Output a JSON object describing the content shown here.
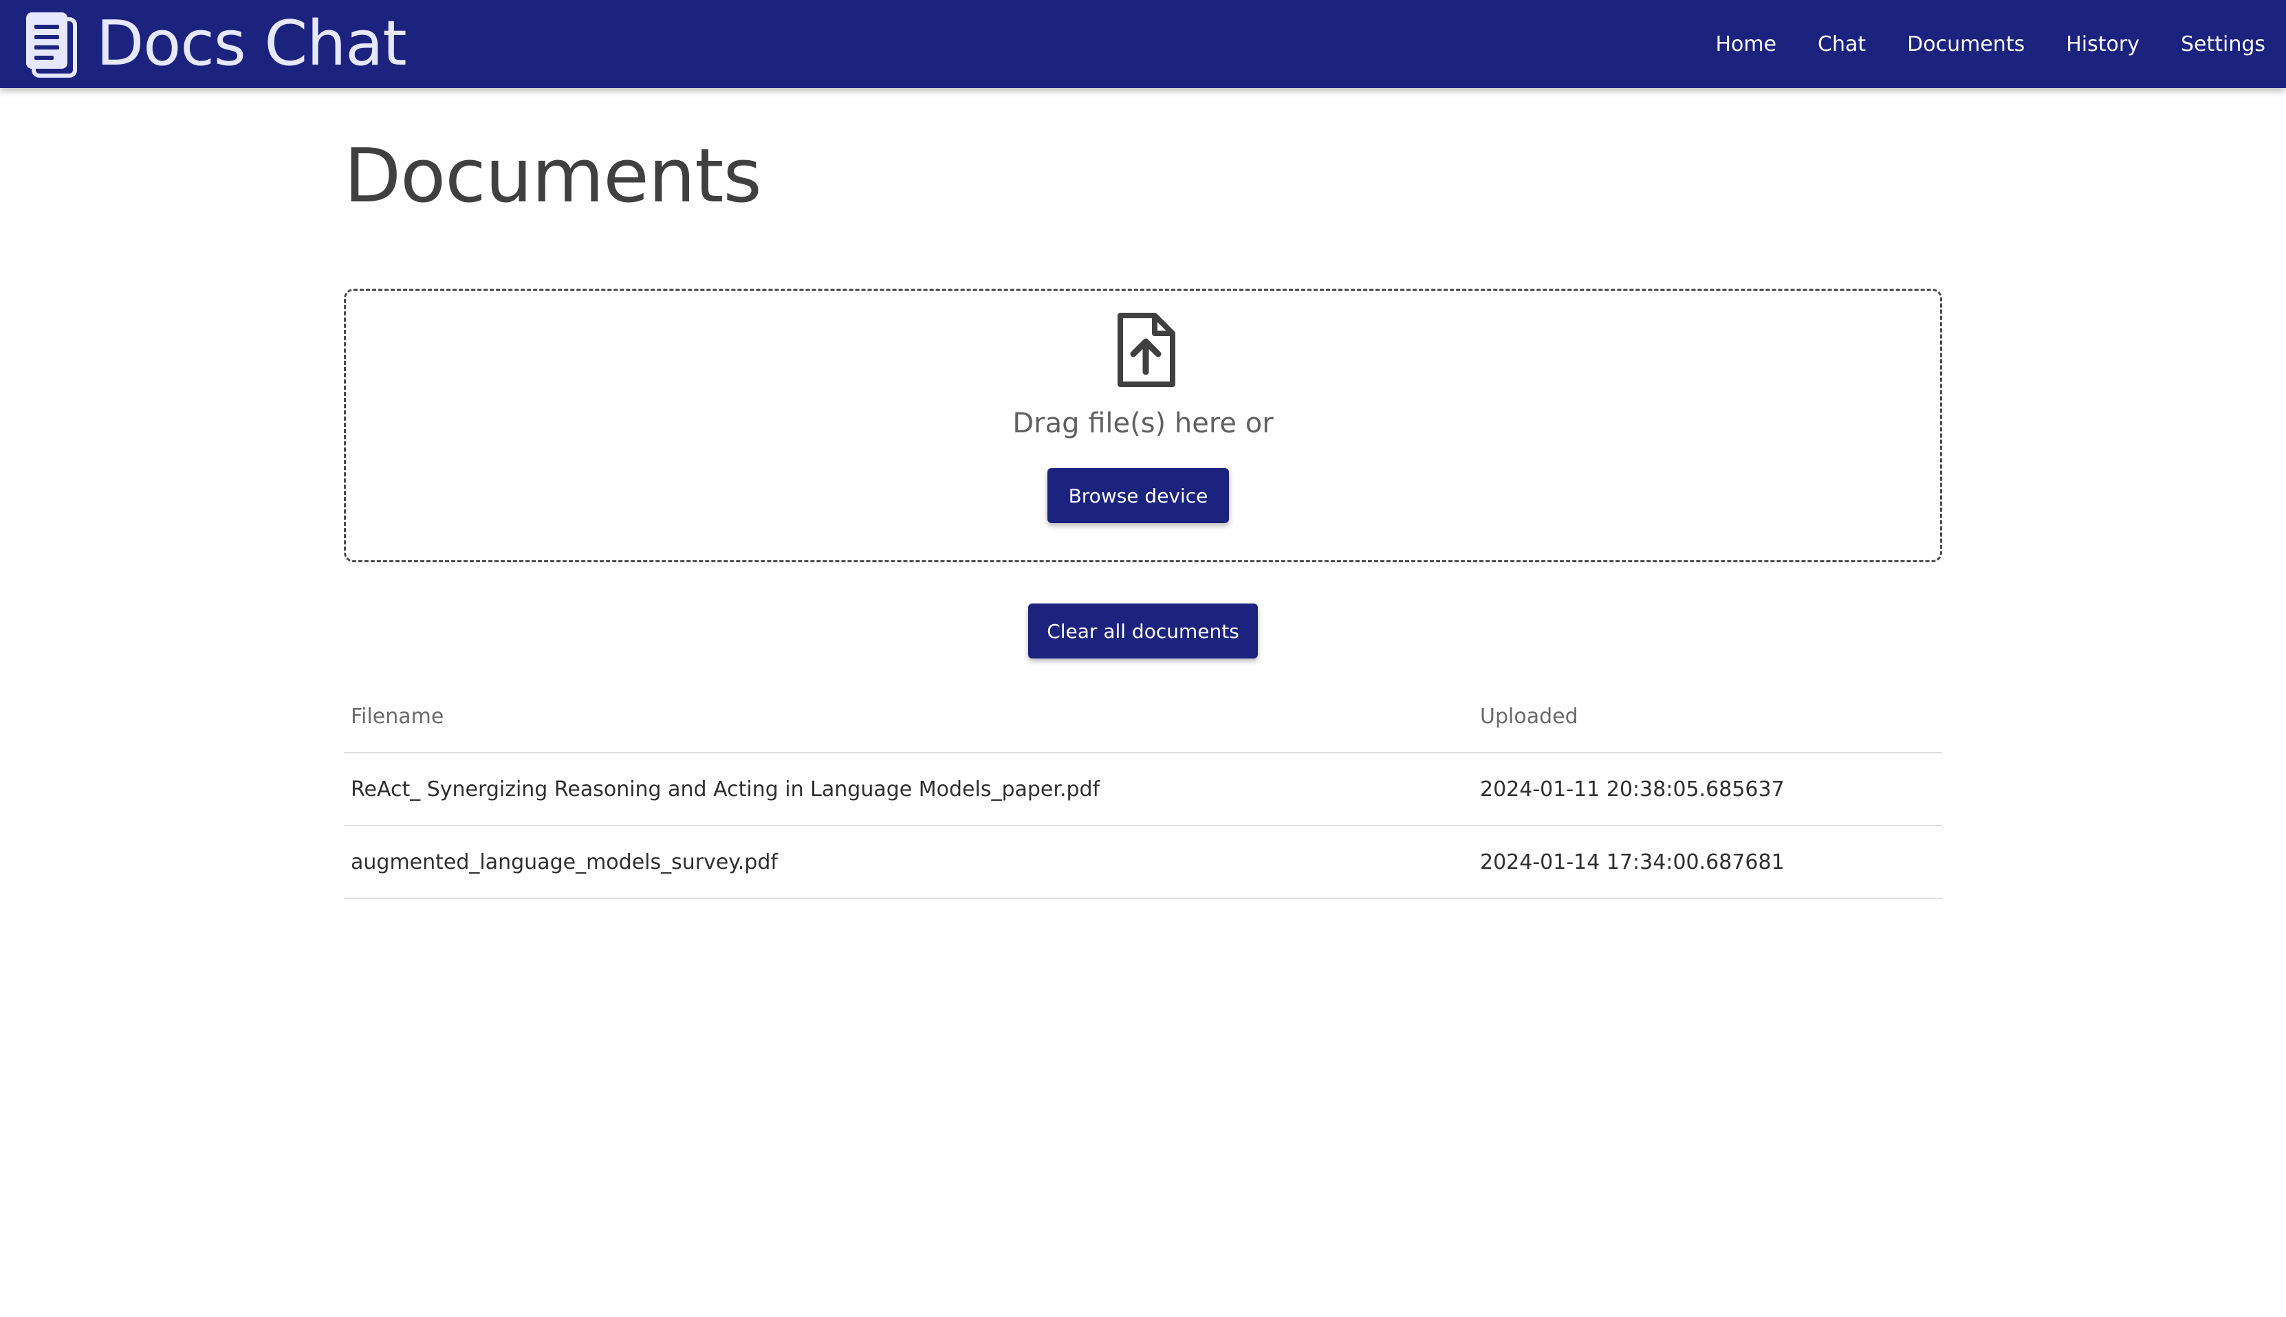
{
  "app": {
    "title": "Docs Chat",
    "logo_icon": "document-icon",
    "brand_color": "#1b237e"
  },
  "nav": {
    "items": [
      {
        "label": "Home"
      },
      {
        "label": "Chat"
      },
      {
        "label": "Documents"
      },
      {
        "label": "History"
      },
      {
        "label": "Settings"
      }
    ]
  },
  "page": {
    "title": "Documents"
  },
  "upload": {
    "icon": "file-upload-icon",
    "prompt": "Drag file(s) here or",
    "browse_label": "Browse device"
  },
  "actions": {
    "clear_label": "Clear all documents"
  },
  "table": {
    "columns": [
      "Filename",
      "Uploaded"
    ],
    "rows": [
      {
        "filename": "ReAct_ Synergizing Reasoning and Acting in Language Models_paper.pdf",
        "uploaded": "2024-01-11 20:38:05.685637"
      },
      {
        "filename": "augmented_language_models_survey.pdf",
        "uploaded": "2024-01-14 17:34:00.687681"
      }
    ]
  }
}
